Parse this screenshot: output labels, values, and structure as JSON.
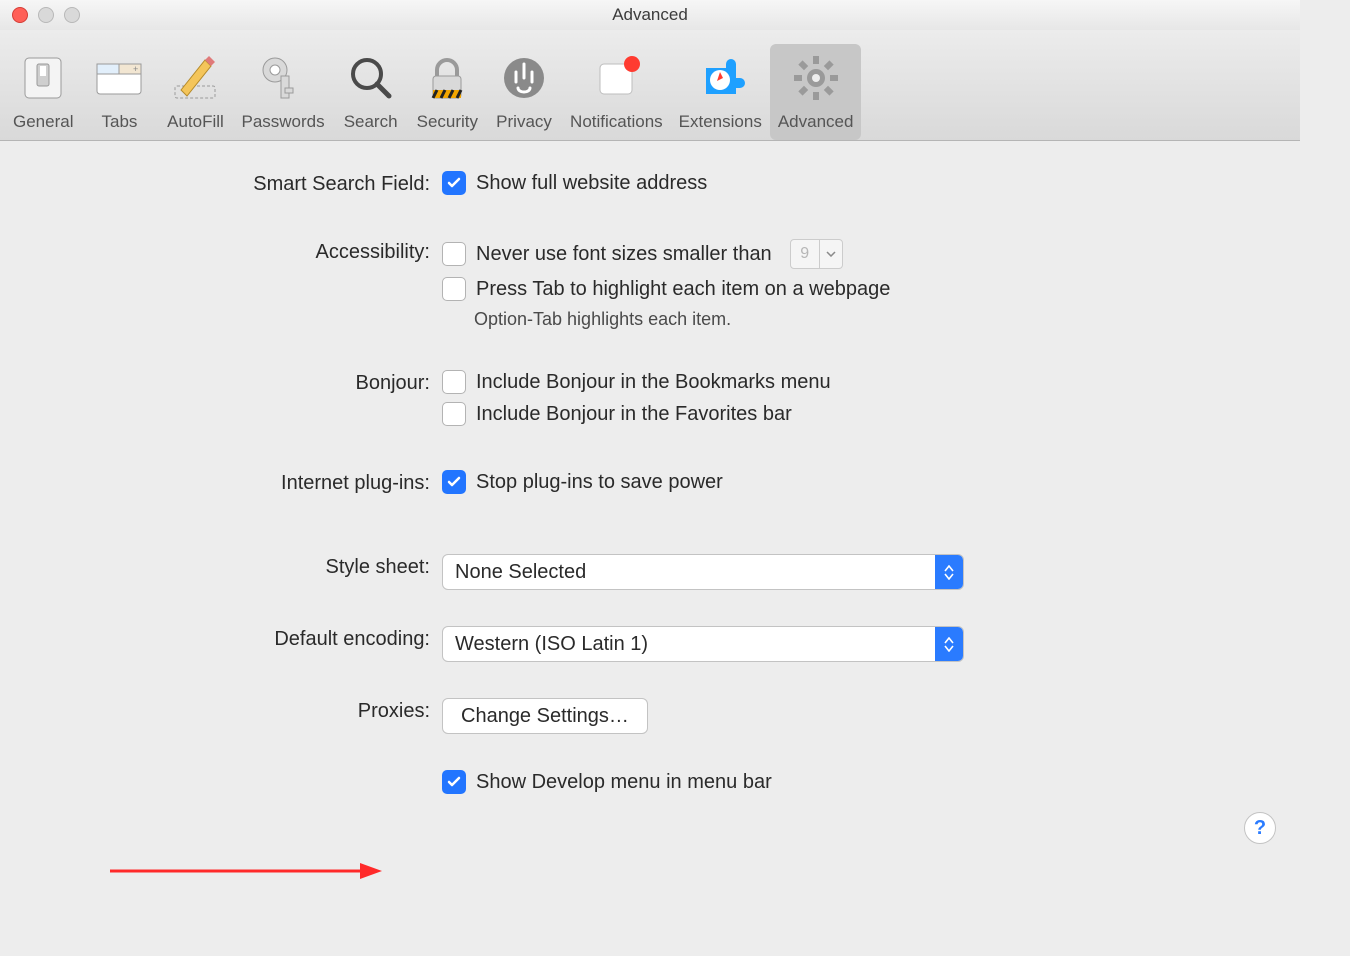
{
  "window": {
    "title": "Advanced"
  },
  "toolbar": [
    {
      "label": "General",
      "name": "tool-general",
      "selected": false
    },
    {
      "label": "Tabs",
      "name": "tool-tabs",
      "selected": false
    },
    {
      "label": "AutoFill",
      "name": "tool-autofill",
      "selected": false
    },
    {
      "label": "Passwords",
      "name": "tool-passwords",
      "selected": false
    },
    {
      "label": "Search",
      "name": "tool-search",
      "selected": false
    },
    {
      "label": "Security",
      "name": "tool-security",
      "selected": false
    },
    {
      "label": "Privacy",
      "name": "tool-privacy",
      "selected": false
    },
    {
      "label": "Notifications",
      "name": "tool-notifications",
      "selected": false
    },
    {
      "label": "Extensions",
      "name": "tool-extensions",
      "selected": false
    },
    {
      "label": "Advanced",
      "name": "tool-advanced",
      "selected": true
    }
  ],
  "sections": {
    "smart_search": {
      "label": "Smart Search Field:",
      "show_full_address": {
        "text": "Show full website address",
        "checked": true
      }
    },
    "accessibility": {
      "label": "Accessibility:",
      "min_font": {
        "text": "Never use font sizes smaller than",
        "checked": false,
        "value": "9"
      },
      "tab_highlight": {
        "text": "Press Tab to highlight each item on a webpage",
        "checked": false
      },
      "note": "Option-Tab highlights each item."
    },
    "bonjour": {
      "label": "Bonjour:",
      "bookmarks": {
        "text": "Include Bonjour in the Bookmarks menu",
        "checked": false
      },
      "favorites": {
        "text": "Include Bonjour in the Favorites bar",
        "checked": false
      }
    },
    "plugins": {
      "label": "Internet plug-ins:",
      "stop_plugins": {
        "text": "Stop plug-ins to save power",
        "checked": true
      }
    },
    "stylesheet": {
      "label": "Style sheet:",
      "value": "None Selected"
    },
    "encoding": {
      "label": "Default encoding:",
      "value": "Western (ISO Latin 1)"
    },
    "proxies": {
      "label": "Proxies:",
      "button": "Change Settings…"
    },
    "develop": {
      "text": "Show Develop menu in menu bar",
      "checked": true
    }
  },
  "help": "?"
}
